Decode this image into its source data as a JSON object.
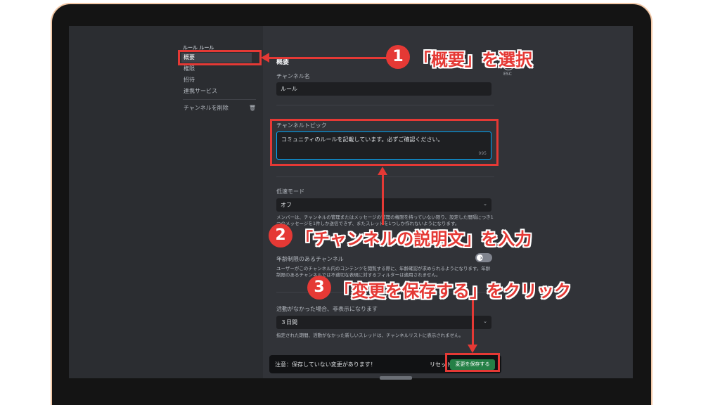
{
  "sidebar": {
    "channel_header": "ルール ルール",
    "items": [
      {
        "label": "概要"
      },
      {
        "label": "権限"
      },
      {
        "label": "招待"
      },
      {
        "label": "連携サービス"
      }
    ],
    "delete_label": "チャンネルを削除"
  },
  "main": {
    "section_title": "概要",
    "channel_name_label": "チャンネル名",
    "channel_name_value": "ルール",
    "topic_label": "チャンネルトピック",
    "topic_value": "コミュニティのルールを記載しています。必ずご確認ください。",
    "topic_counter": "995",
    "slowmode_label": "低速モード",
    "slowmode_value": "オフ",
    "slowmode_help": "メンバーは、チャンネルの管理またはメッセージの管理の権限を持っていない限り、設定した間隔につき1つのメッセージを1件しか送信できず、またスレッドを1つしか作れないようになります。",
    "age_label": "年齢制限のあるチャンネル",
    "age_help": "ユーザーがこのチャンネル内のコンテンツを閲覧する際に、年齢確認が求められるようになります。年齢制限のあるチャンネルでは不適切な表現に対するフィルターは適用されません。",
    "inactive_label": "活動がなかった場合、非表示になります",
    "inactive_value": "３日間",
    "inactive_help": "指定された期間、活動がなかった新しいスレッドは、チャンネルリストに表示されません。"
  },
  "esc": {
    "label": "ESC",
    "icon": "close-icon"
  },
  "unsaved_bar": {
    "message": "注意：保存していない変更があります！",
    "reset_label": "リセット",
    "save_label": "変更を保存する"
  },
  "annotations": {
    "step1_number": "1",
    "step1_text": "「概要」を選択",
    "step2_number": "2",
    "step2_text": "「チャンネルの説明文」を入力",
    "step3_number": "3",
    "step3_text": "「変更を保存する」をクリック",
    "accent_color": "#e53935"
  }
}
